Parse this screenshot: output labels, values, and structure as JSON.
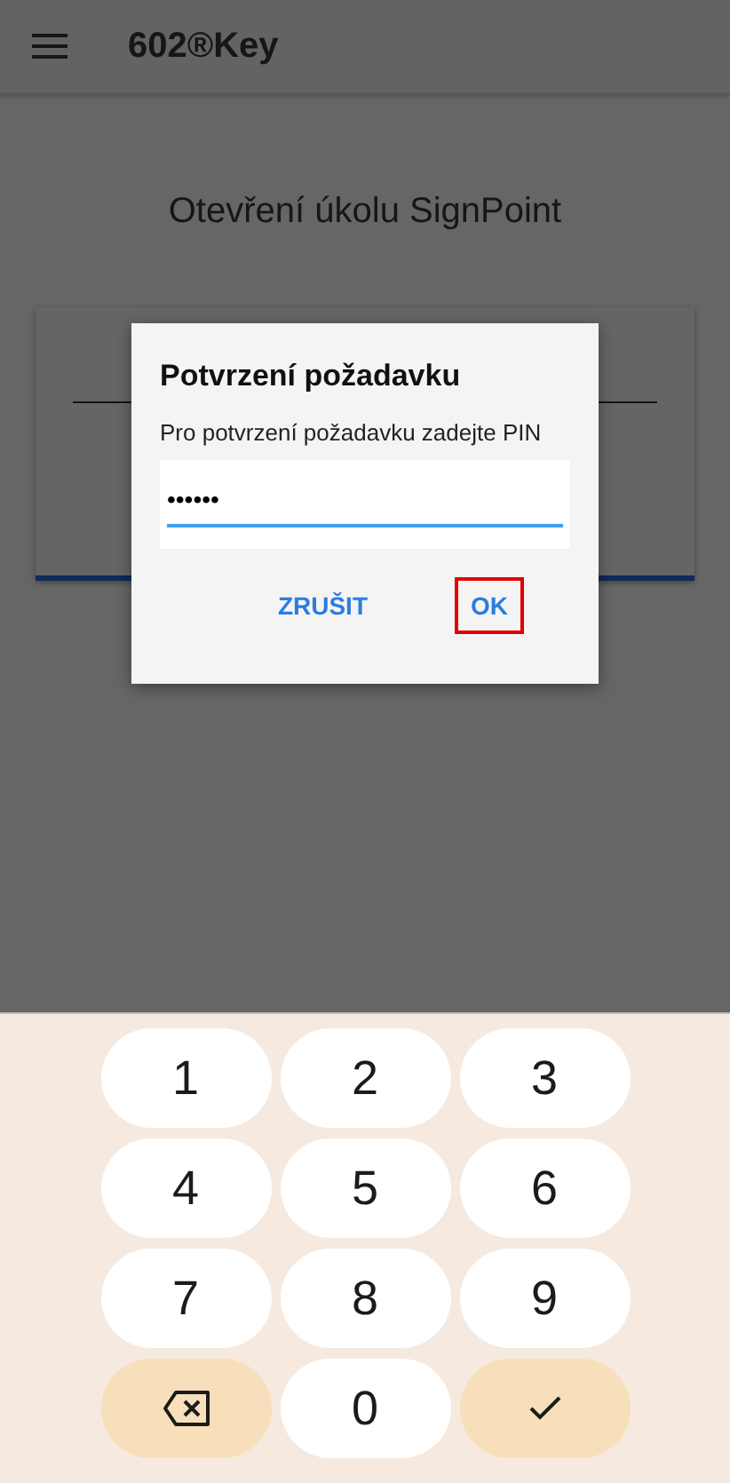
{
  "app_bar": {
    "title": "602®Key"
  },
  "page": {
    "heading": "Otevření úkolu SignPoint"
  },
  "dialog": {
    "title": "Potvrzení požadavku",
    "message": "Pro potvrzení požadavku zadejte PIN",
    "pin_field": {
      "value": "••••••"
    },
    "buttons": [
      {
        "label": "ZRUŠIT",
        "highlighted": false
      },
      {
        "label": "OK",
        "highlighted": true
      }
    ]
  },
  "keypad": [
    {
      "kind": "digit",
      "label": "1"
    },
    {
      "kind": "digit",
      "label": "2"
    },
    {
      "kind": "digit",
      "label": "3"
    },
    {
      "kind": "digit",
      "label": "4"
    },
    {
      "kind": "digit",
      "label": "5"
    },
    {
      "kind": "digit",
      "label": "6"
    },
    {
      "kind": "digit",
      "label": "7"
    },
    {
      "kind": "digit",
      "label": "8"
    },
    {
      "kind": "digit",
      "label": "9"
    },
    {
      "kind": "backspace"
    },
    {
      "kind": "digit",
      "label": "0"
    },
    {
      "kind": "done"
    }
  ]
}
